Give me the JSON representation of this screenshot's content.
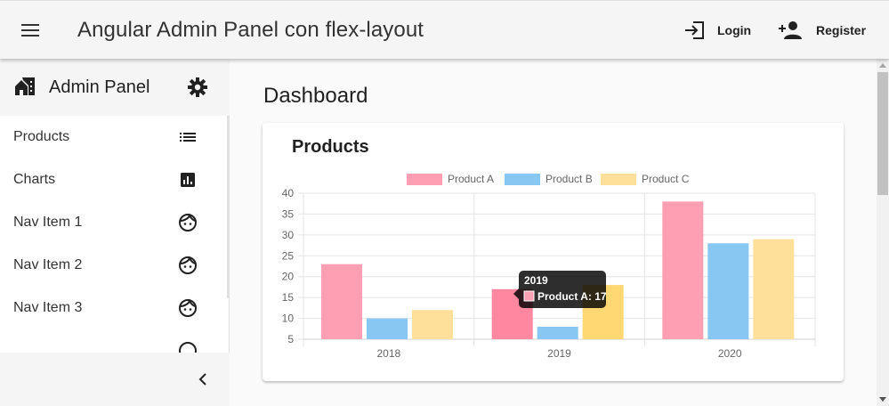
{
  "toolbar": {
    "menu_icon": "menu-icon",
    "title": "Angular Admin Panel con flex-layout",
    "login_label": "Login",
    "login_icon": "login-icon",
    "register_label": "Register",
    "register_icon": "person-add-icon"
  },
  "sidebar": {
    "title": "Admin Panel",
    "home_icon": "home-work-icon",
    "settings_icon": "gear-icon",
    "items": [
      {
        "label": "Products",
        "icon": "list-icon"
      },
      {
        "label": "Charts",
        "icon": "bar-chart-icon"
      },
      {
        "label": "Nav Item 1",
        "icon": "face-icon"
      },
      {
        "label": "Nav Item 2",
        "icon": "face-icon"
      },
      {
        "label": "Nav Item 3",
        "icon": "face-icon"
      }
    ],
    "collapse_icon": "chevron-left-icon"
  },
  "main": {
    "page_title": "Dashboard",
    "card_title": "Products"
  },
  "chart_data": {
    "type": "bar",
    "categories": [
      "2018",
      "2019",
      "2020"
    ],
    "series": [
      {
        "name": "Product A",
        "values": [
          23,
          17,
          38
        ],
        "color": "#ff9fb3"
      },
      {
        "name": "Product B",
        "values": [
          10,
          8,
          28
        ],
        "color": "#88c7f2"
      },
      {
        "name": "Product C",
        "values": [
          12,
          18,
          29
        ],
        "color": "#ffe09b"
      }
    ],
    "ylim": [
      5,
      40
    ],
    "yticks": [
      5,
      10,
      15,
      20,
      25,
      30,
      35,
      40
    ],
    "legend_position": "top",
    "grid": true,
    "tooltip": {
      "title": "2019",
      "label": "Product A: 17"
    },
    "highlight": {
      "category": "2019",
      "series": [
        "Product A",
        "Product C"
      ]
    }
  }
}
